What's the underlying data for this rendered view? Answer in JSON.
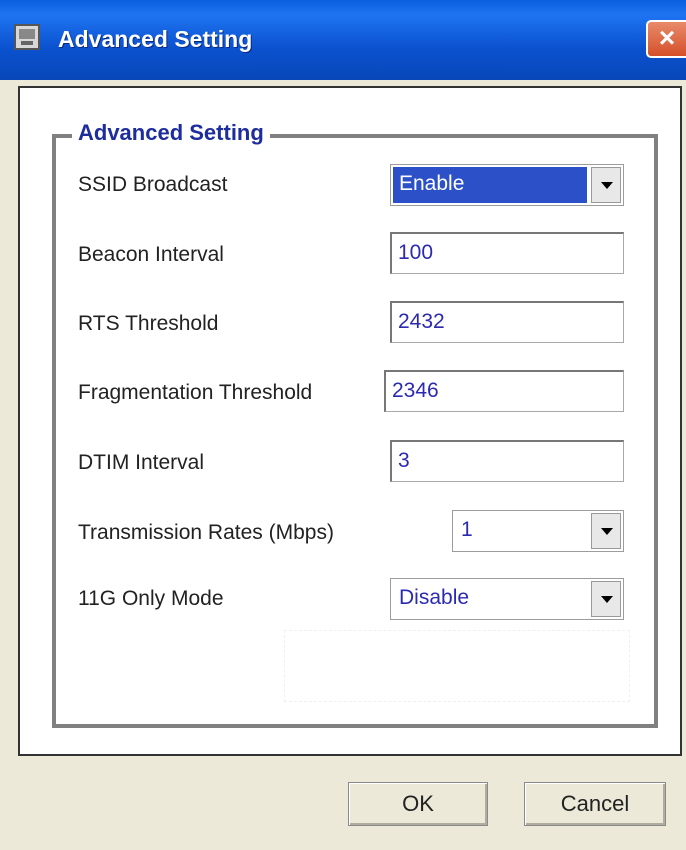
{
  "window": {
    "title": "Advanced Setting",
    "close_label": "×"
  },
  "group": {
    "legend": "Advanced Setting"
  },
  "rows": {
    "ssid_broadcast": {
      "label": "SSID Broadcast",
      "value": "Enable"
    },
    "beacon_interval": {
      "label": "Beacon Interval",
      "value": "100"
    },
    "rts_threshold": {
      "label": "RTS Threshold",
      "value": "2432"
    },
    "fragmentation_threshold": {
      "label": "Fragmentation Threshold",
      "value": "2346"
    },
    "dtim_interval": {
      "label": "DTIM Interval",
      "value": "3"
    },
    "transmission_rates": {
      "label": "Transmission Rates (Mbps)",
      "value": "1"
    },
    "only_11g_mode": {
      "label": "11G Only Mode",
      "value": "Disable"
    }
  },
  "buttons": {
    "ok": "OK",
    "cancel": "Cancel"
  },
  "colors": {
    "titlebar": "#0b52cf",
    "value_text": "#2b2ab0",
    "selection": "#2b50c8",
    "legend_text": "#1e2d9c"
  },
  "icons": {
    "app": "window-app-icon",
    "close": "close-icon",
    "dropdown": "dropdown-arrow-icon"
  }
}
